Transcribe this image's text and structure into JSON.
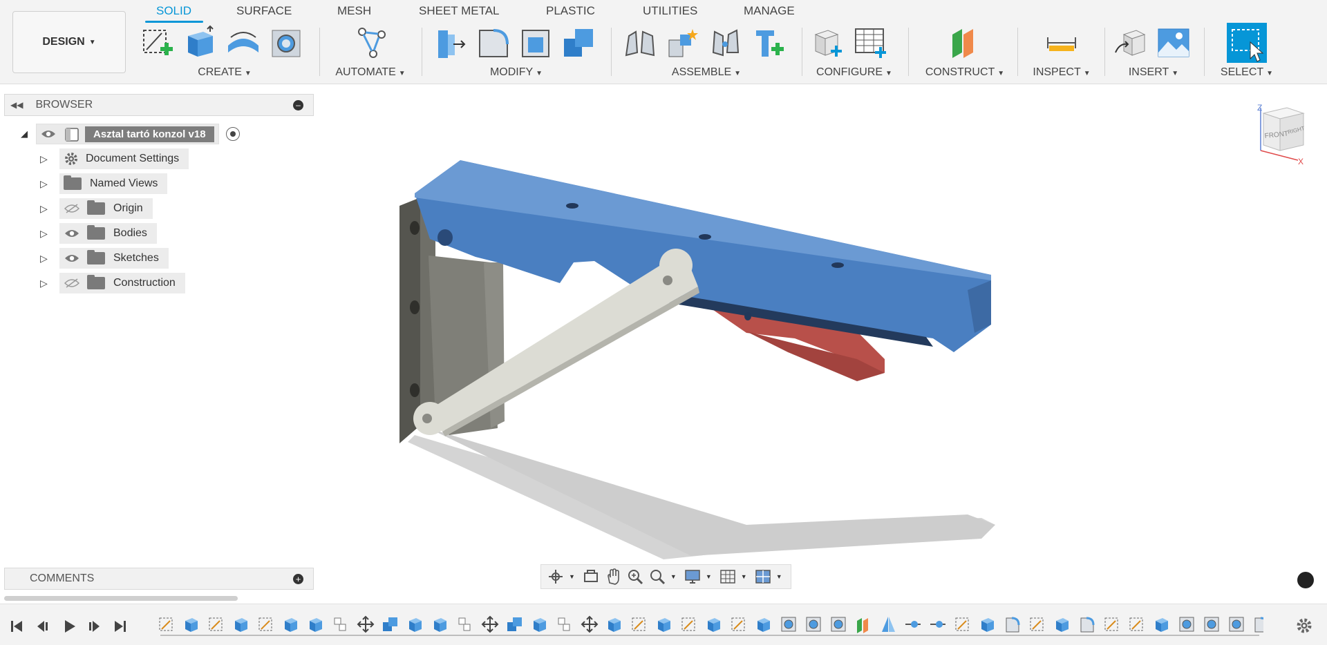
{
  "workspace": {
    "label": "DESIGN"
  },
  "tabs": [
    {
      "label": "SOLID",
      "active": true
    },
    {
      "label": "SURFACE"
    },
    {
      "label": "MESH"
    },
    {
      "label": "SHEET METAL"
    },
    {
      "label": "PLASTIC"
    },
    {
      "label": "UTILITIES"
    },
    {
      "label": "MANAGE"
    }
  ],
  "groups": {
    "create": "CREATE",
    "automate": "AUTOMATE",
    "modify": "MODIFY",
    "assemble": "ASSEMBLE",
    "configure": "CONFIGURE",
    "construct": "CONSTRUCT",
    "inspect": "INSPECT",
    "insert": "INSERT",
    "select": "SELECT"
  },
  "browser": {
    "title": "BROWSER",
    "root": "Asztal tartó konzol v18",
    "nodes": [
      "Document Settings",
      "Named Views",
      "Origin",
      "Bodies",
      "Sketches",
      "Construction"
    ]
  },
  "comments": {
    "title": "COMMENTS"
  },
  "viewcube": {
    "face_front": "FRONT",
    "face_right": "RIGHT",
    "axis_z": "Z",
    "axis_x": "X"
  },
  "colors": {
    "accent": "#0696d7",
    "body_blue": "#4a7fc1",
    "link_grey": "#dcdcd4",
    "plate_dark": "#55554f",
    "part_red": "#b8504a"
  }
}
